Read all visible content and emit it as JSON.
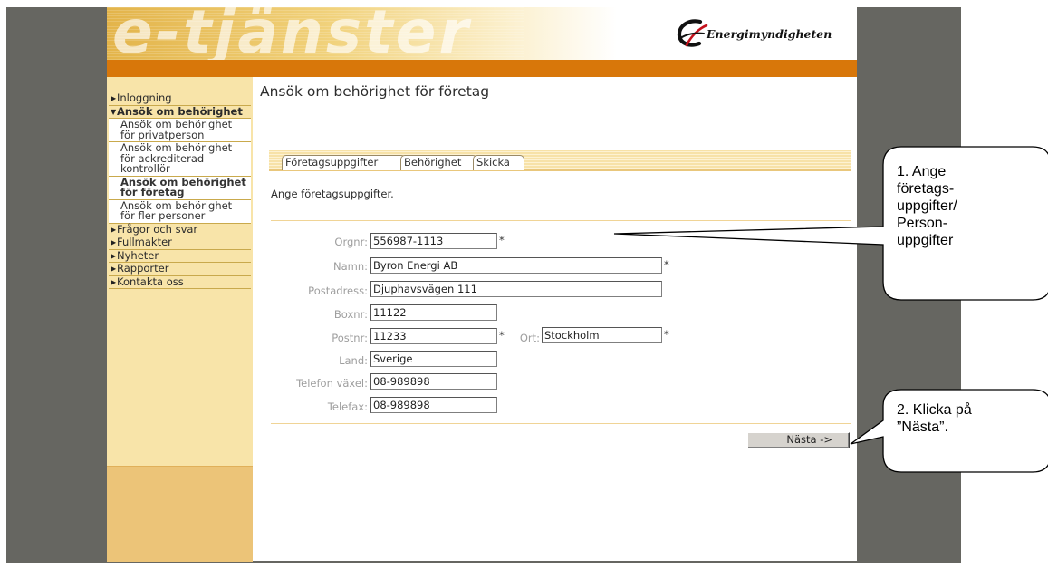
{
  "header": {
    "logo_text": "e-tjänster",
    "brand_name": "Energimyndigheten"
  },
  "sidebar": {
    "items": [
      {
        "label": "Inloggning",
        "arrow": "right"
      },
      {
        "label": "Ansök om behörighet",
        "arrow": "down",
        "expanded": true
      },
      {
        "label": "Frågor och svar",
        "arrow": "right"
      },
      {
        "label": "Fullmakter",
        "arrow": "right"
      },
      {
        "label": "Nyheter",
        "arrow": "right"
      },
      {
        "label": "Rapporter",
        "arrow": "right"
      },
      {
        "label": "Kontakta oss",
        "arrow": "right"
      }
    ],
    "subitems": [
      {
        "label": "Ansök om behörighet för privatperson",
        "selected": false
      },
      {
        "label": "Ansök om behörighet för ackrediterad kontrollör",
        "selected": false
      },
      {
        "label": "Ansök om behörighet för företag",
        "selected": true
      },
      {
        "label": "Ansök om behörighet för fler personer",
        "selected": false
      }
    ]
  },
  "main": {
    "title": "Ansök om behörighet för företag",
    "tabs": [
      {
        "label": "Företagsuppgifter",
        "active": true
      },
      {
        "label": "Behörighet",
        "active": false
      },
      {
        "label": "Skicka",
        "active": false
      }
    ],
    "instruction": "Ange företagsuppgifter.",
    "required_marker": "*",
    "fields": {
      "orgnr": {
        "label": "Orgnr:",
        "value": "556987-1113",
        "required": true
      },
      "namn": {
        "label": "Namn:",
        "value": "Byron Energi AB",
        "required": true
      },
      "postadress": {
        "label": "Postadress:",
        "value": "Djuphavsvägen 111",
        "required": false
      },
      "boxnr": {
        "label": "Boxnr:",
        "value": "11122",
        "required": false
      },
      "postnr": {
        "label": "Postnr:",
        "value": "11233",
        "required": true
      },
      "ort": {
        "label": "Ort:",
        "value": "Stockholm",
        "required": true
      },
      "land": {
        "label": "Land:",
        "value": "Sverige",
        "required": false
      },
      "telefon": {
        "label": "Telefon växel:",
        "value": "08-989898",
        "required": false
      },
      "telefax": {
        "label": "Telefax:",
        "value": "08-989898",
        "required": false
      }
    },
    "next_button": "Nästa ->"
  },
  "callouts": [
    {
      "lines": [
        "1. Ange",
        "företags-",
        "uppgifter/",
        "Person-",
        "uppgifter"
      ]
    },
    {
      "lines": [
        "2. Klicka på",
        "”Nästa”."
      ]
    }
  ],
  "colors": {
    "frame_grey": "#666661",
    "orange_bar": "#d8770a",
    "sidebar_bg": "#f8e4a9",
    "sidebar_bottom": "#ecc478",
    "tabbar": "#f7e2a8"
  }
}
